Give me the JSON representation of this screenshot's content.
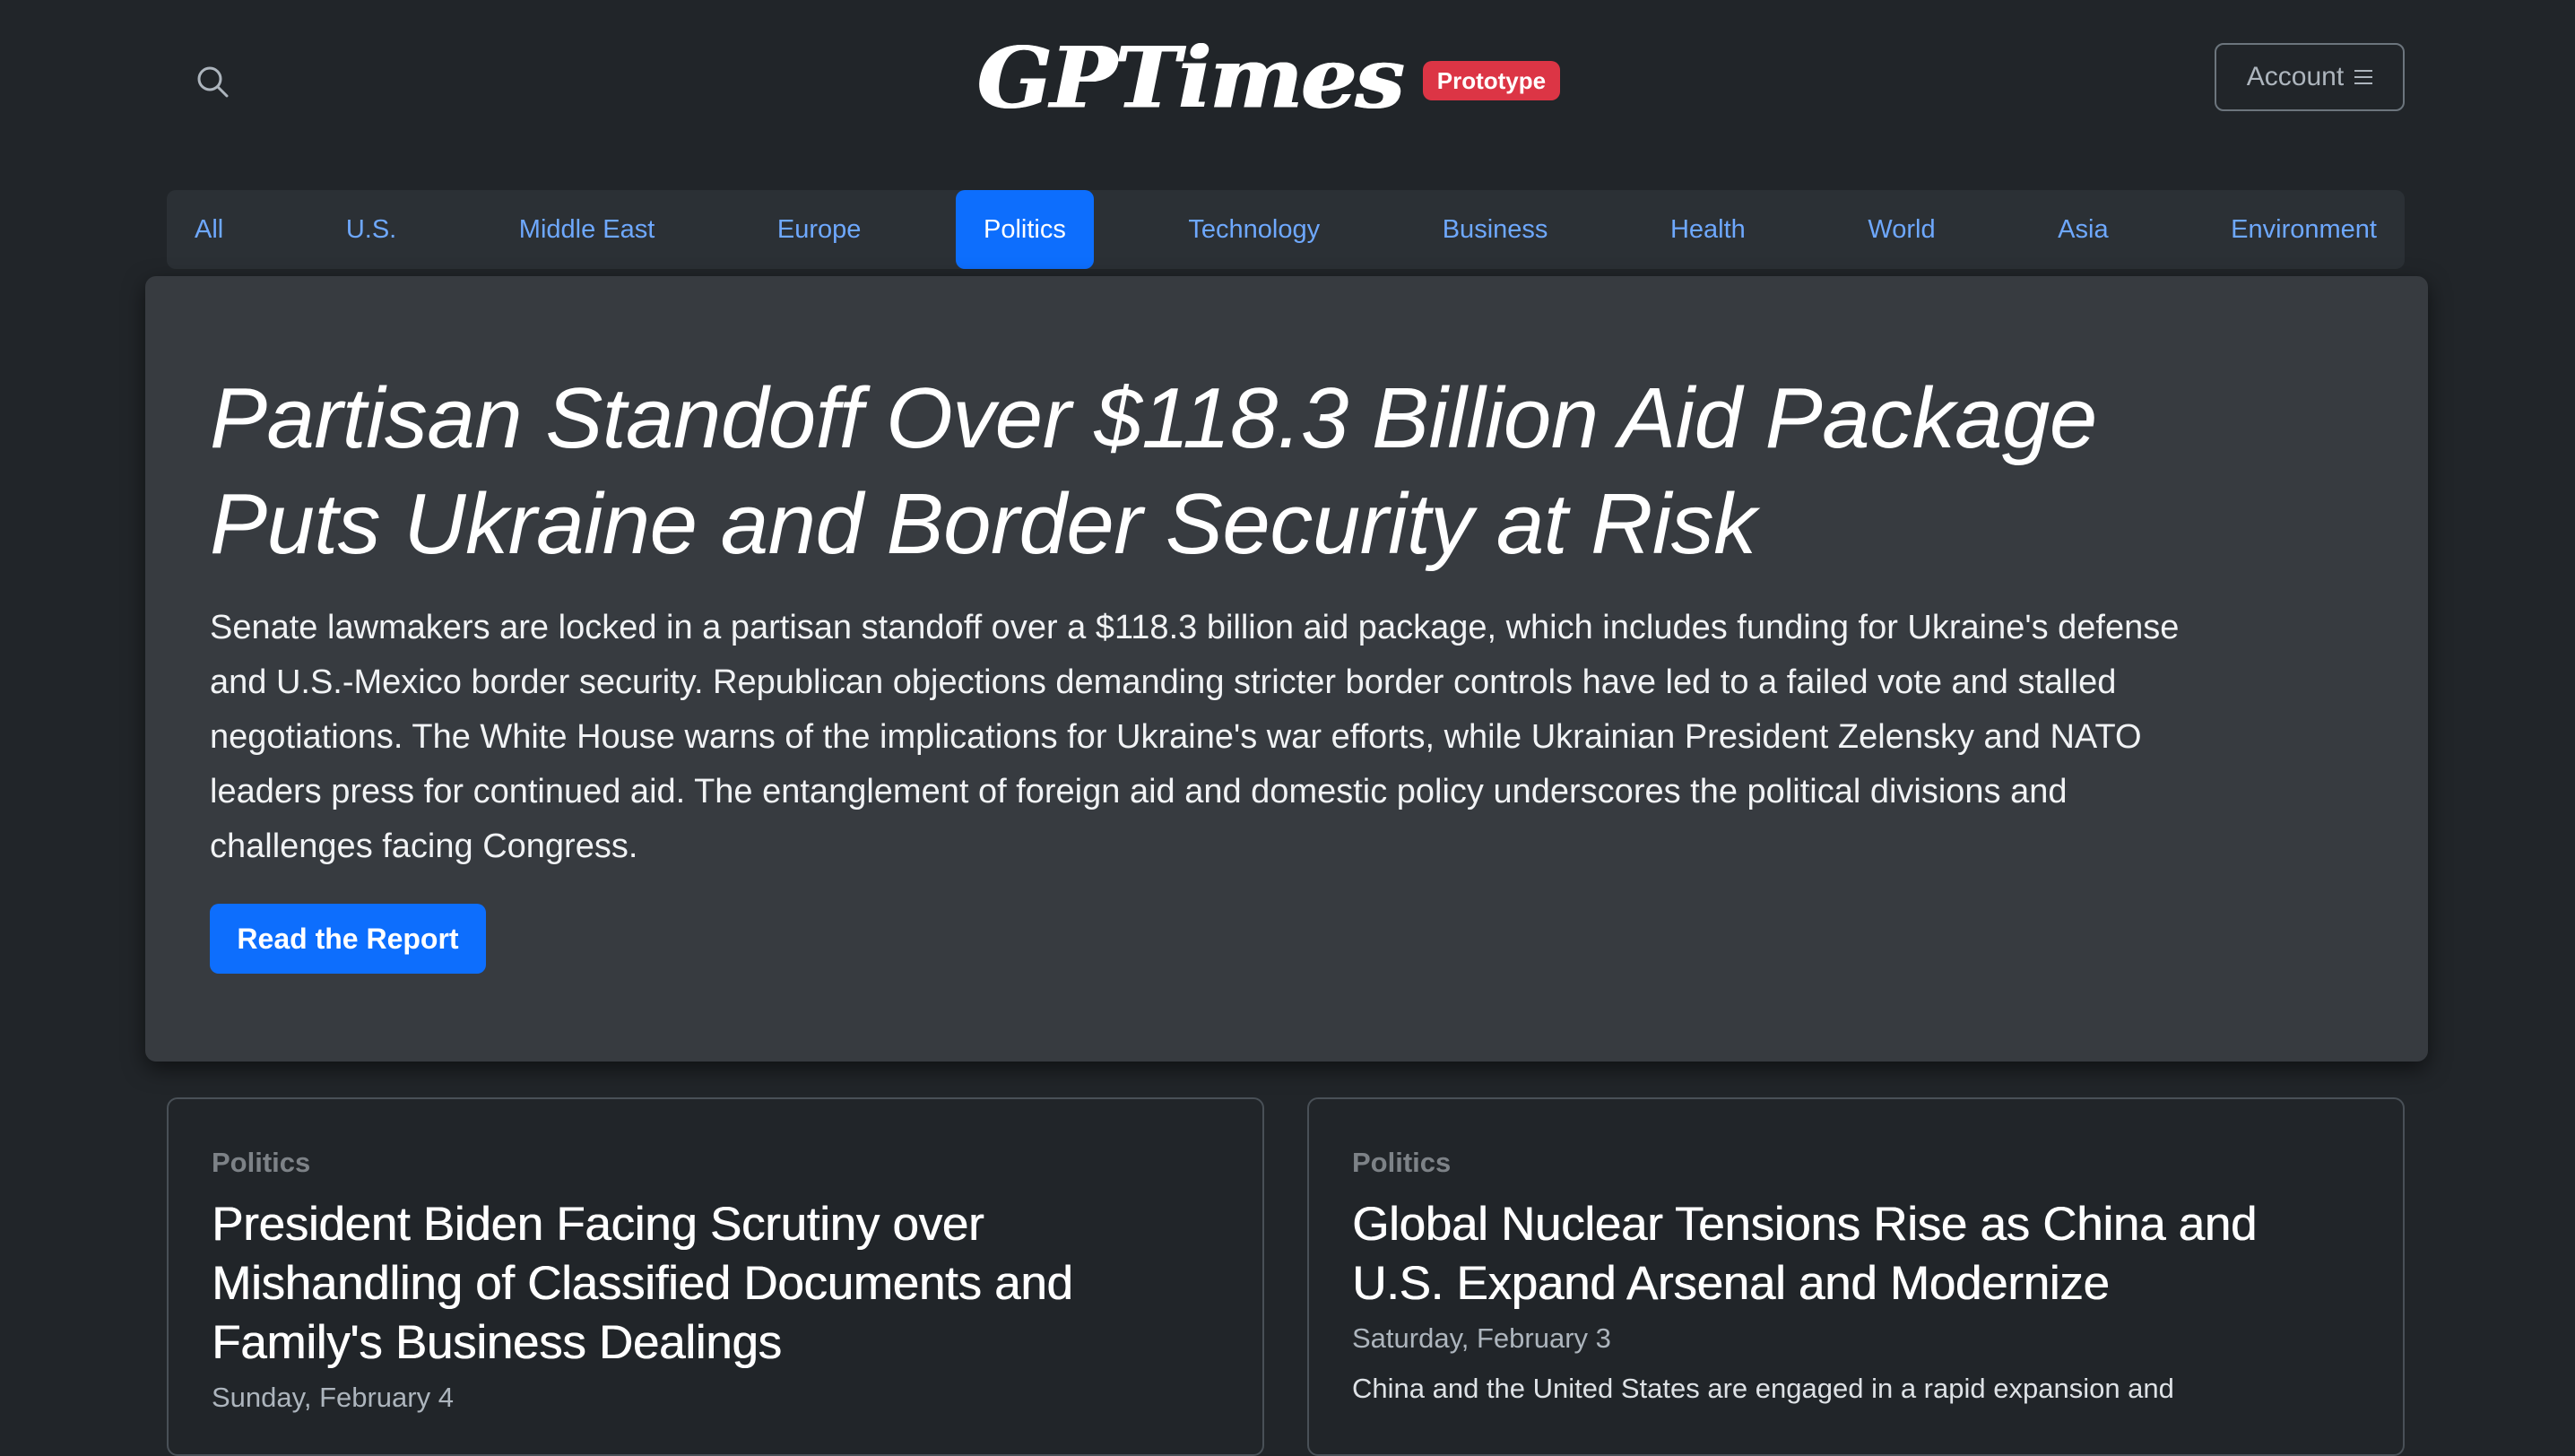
{
  "header": {
    "logo": "GPTimes",
    "badge": "Prototype",
    "account_label": "Account"
  },
  "nav": {
    "items": [
      {
        "label": "All"
      },
      {
        "label": "U.S."
      },
      {
        "label": "Middle East"
      },
      {
        "label": "Europe"
      },
      {
        "label": "Politics",
        "active": true
      },
      {
        "label": "Technology"
      },
      {
        "label": "Business"
      },
      {
        "label": "Health"
      },
      {
        "label": "World"
      },
      {
        "label": "Asia"
      },
      {
        "label": "Environment"
      }
    ]
  },
  "hero": {
    "title": "Partisan Standoff Over $118.3 Billion Aid Package Puts Ukraine and Border Security at Risk",
    "summary": "Senate lawmakers are locked in a partisan standoff over a $118.3 billion aid package, which includes funding for Ukraine's defense and U.S.-Mexico border security. Republican objections demanding stricter border controls have led to a failed vote and stalled negotiations. The White House warns of the implications for Ukraine's war efforts, while Ukrainian President Zelensky and NATO leaders press for continued aid. The entanglement of foreign aid and domestic policy underscores the political divisions and challenges facing Congress.",
    "button_label": "Read the Report"
  },
  "cards": [
    {
      "category": "Politics",
      "title": "President Biden Facing Scrutiny over Mishandling of Classified Documents and Family's Business Dealings",
      "date": "Sunday, February 4",
      "excerpt": ""
    },
    {
      "category": "Politics",
      "title": "Global Nuclear Tensions Rise as China and U.S. Expand Arsenal and Modernize",
      "date": "Saturday, February 3",
      "excerpt": "China and the United States are engaged in a rapid expansion and"
    }
  ],
  "colors": {
    "background": "#212529",
    "hero_background": "#373b40",
    "nav_background": "#2b3035",
    "accent": "#0d6efd",
    "nav_link": "#6ea8fe",
    "badge": "#dc3545"
  },
  "icons": {
    "search": "search-icon",
    "menu": "menu-icon"
  }
}
